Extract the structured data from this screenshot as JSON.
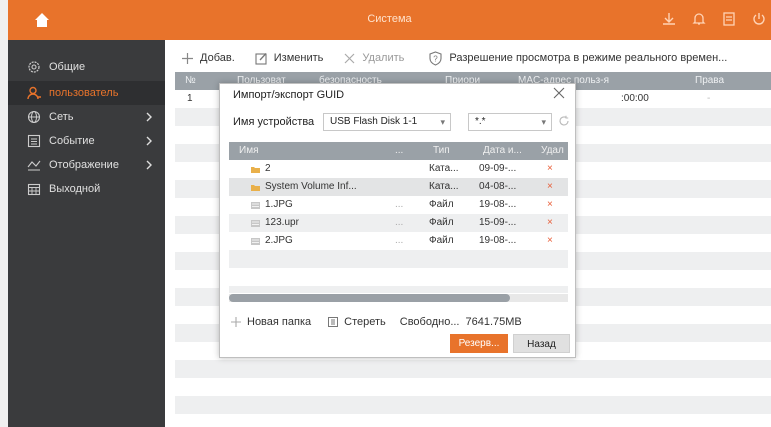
{
  "topbar": {
    "title": "Система",
    "accent": "#e8732b"
  },
  "sidebar": {
    "items": [
      {
        "label": "Общие",
        "icon": "gear-icon"
      },
      {
        "label": "пользователь",
        "icon": "user-icon"
      },
      {
        "label": "Сеть",
        "icon": "globe-icon"
      },
      {
        "label": "Событие",
        "icon": "list-icon"
      },
      {
        "label": "Отображение",
        "icon": "eye-icon"
      },
      {
        "label": "Выходной",
        "icon": "calendar-icon"
      }
    ]
  },
  "toolbar": {
    "add": "Добав.",
    "edit": "Изменить",
    "delete": "Удалить",
    "permission": "Разрешение просмотра в режиме реального времен..."
  },
  "users_table": {
    "headers": [
      "№",
      "Пользоват",
      "безопасность",
      "Приори",
      "MAC-адрес польз-я",
      "Права"
    ],
    "rows": [
      {
        "no": "1",
        "mac": ":00:00",
        "rights": "-"
      }
    ]
  },
  "dialog": {
    "title": "Импорт/экспорт GUID",
    "device_label": "Имя устройства",
    "device_value": "USB Flash Disk 1-1",
    "filter_value": "*.*",
    "headers": {
      "name": "Имя",
      "dots": "...",
      "type": "Тип",
      "date": "Дата и...",
      "delete": "Удал"
    },
    "files": [
      {
        "name": "2",
        "dots": "",
        "type": "Ката...",
        "date": "09-09-...",
        "del": "×",
        "kind": "folder"
      },
      {
        "name": "System Volume Inf...",
        "dots": "",
        "type": "Ката...",
        "date": "04-08-...",
        "del": "×",
        "kind": "folder"
      },
      {
        "name": "1.JPG",
        "dots": "...",
        "type": "Файл",
        "date": "19-08-...",
        "del": "×",
        "kind": "file"
      },
      {
        "name": "123.upr",
        "dots": "...",
        "type": "Файл",
        "date": "15-09-...",
        "del": "×",
        "kind": "file"
      },
      {
        "name": "2.JPG",
        "dots": "...",
        "type": "Файл",
        "date": "19-08-...",
        "del": "×",
        "kind": "file"
      }
    ],
    "new_folder": "Новая папка",
    "erase": "Стереть",
    "free_label": "Свободно...",
    "free_value": "7641.75MB",
    "backup_button": "Резерв...",
    "back_button": "Назад",
    "scroll_fraction": 0.83
  }
}
